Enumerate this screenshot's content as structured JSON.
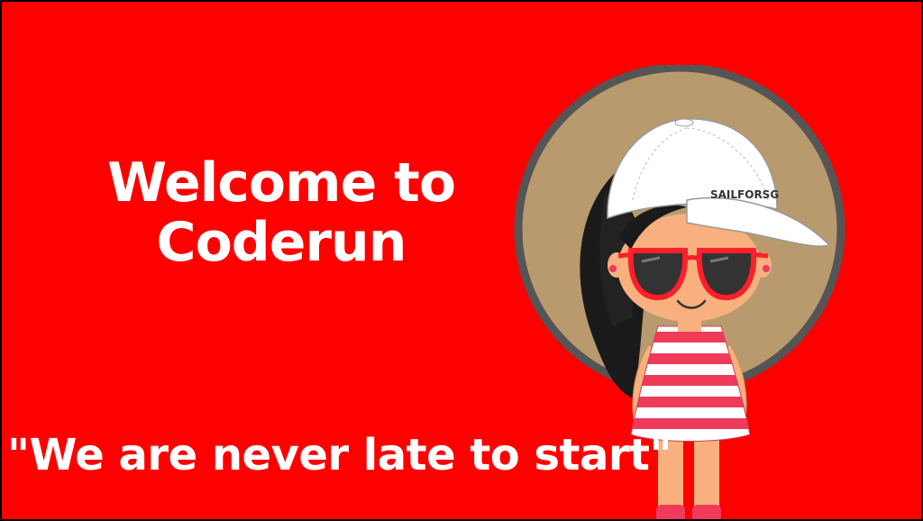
{
  "slide": {
    "title_line1": "Welcome to",
    "title_line2": "Coderun",
    "tagline": "\"We are never late to start\"",
    "cap_text": "SAILFORSG"
  },
  "colors": {
    "background": "#ff0000",
    "text": "#ffffff",
    "circle_fill": "#b89a6e",
    "circle_border": "#555555",
    "sunglasses_frame": "#ff1f2a",
    "dress_stripe": "#ef3a5a",
    "skin": "#f7b07e"
  },
  "icons": {
    "character": "girl-with-cap-and-sunglasses-icon"
  }
}
